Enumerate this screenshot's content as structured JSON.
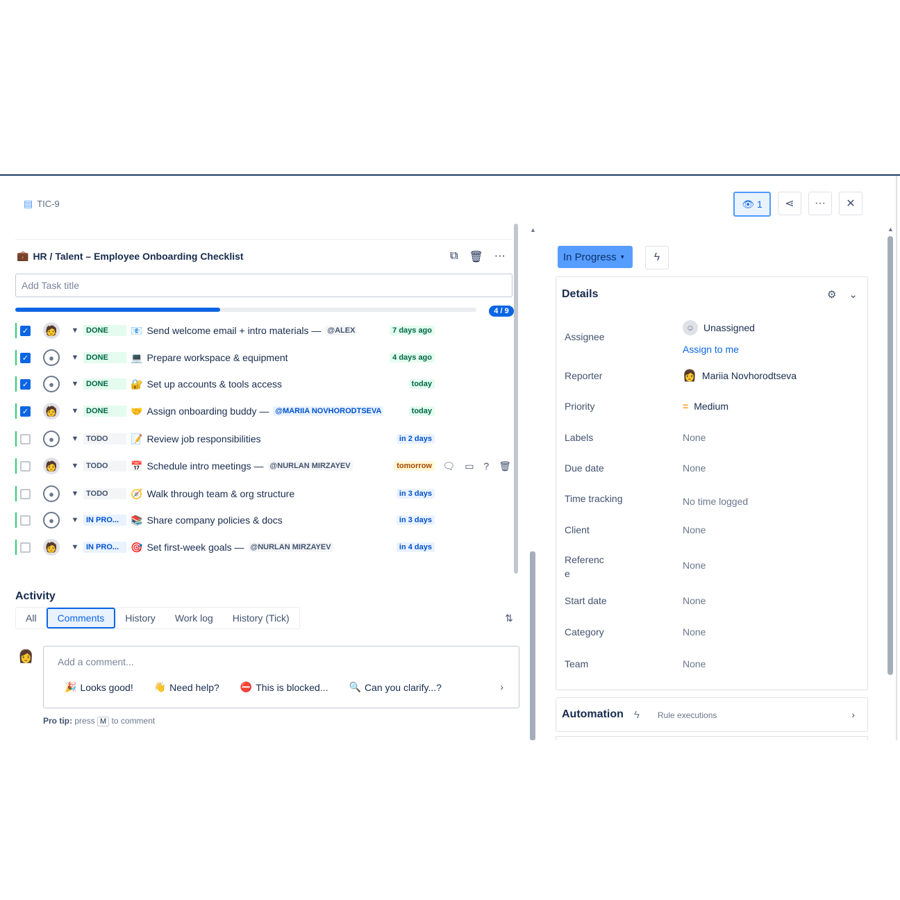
{
  "header": {
    "issue_key": "TIC-9",
    "watch_count": "1",
    "actions": [
      "eye-icon",
      "share-icon",
      "more-icon",
      "close-icon"
    ]
  },
  "checklist": {
    "title": "HR / Talent – Employee Onboarding Checklist",
    "add_placeholder": "Add Task title",
    "progress_fraction": 0.444,
    "progress_label": "4 / 9",
    "tasks": [
      {
        "checked": true,
        "avatar": "photo",
        "status": "DONE",
        "icon": "📧",
        "name": "Send welcome email + intro materials —",
        "mention": "@ALEX",
        "mention_style": "grey",
        "due": "7 days ago",
        "due_style": "green"
      },
      {
        "checked": true,
        "avatar": "default",
        "status": "DONE",
        "icon": "💻",
        "name": "Prepare workspace & equipment",
        "mention": "",
        "mention_style": "",
        "due": "4 days ago",
        "due_style": "green"
      },
      {
        "checked": true,
        "avatar": "default",
        "status": "DONE",
        "icon": "🔐",
        "name": "Set up accounts & tools access",
        "mention": "",
        "mention_style": "",
        "due": "today",
        "due_style": "green"
      },
      {
        "checked": true,
        "avatar": "photo",
        "status": "DONE",
        "icon": "🤝",
        "name": "Assign onboarding buddy —",
        "mention": "@MARIIA NOVHORODTSEVA",
        "mention_style": "blue",
        "due": "today",
        "due_style": "green"
      },
      {
        "checked": false,
        "avatar": "default",
        "status": "TODO",
        "icon": "📝",
        "name": "Review job responsibilities",
        "mention": "",
        "mention_style": "",
        "due": "in 2 days",
        "due_style": "blue"
      },
      {
        "checked": false,
        "avatar": "photo",
        "status": "TODO",
        "icon": "📅",
        "name": "Schedule intro meetings —",
        "mention": "@NURLAN MIRZAYEV",
        "mention_style": "grey",
        "due": "tomorrow",
        "due_style": "orange"
      },
      {
        "checked": false,
        "avatar": "default",
        "status": "TODO",
        "icon": "🧭",
        "name": "Walk through team & org structure",
        "mention": "",
        "mention_style": "",
        "due": "in 3 days",
        "due_style": "blue"
      },
      {
        "checked": false,
        "avatar": "default",
        "status": "IN PRO...",
        "icon": "📚",
        "name": "Share company policies & docs",
        "mention": "",
        "mention_style": "",
        "due": "in 3 days",
        "due_style": "blue"
      },
      {
        "checked": false,
        "avatar": "photo",
        "status": "IN PRO...",
        "icon": "🎯",
        "name": "Set first-week goals —",
        "mention": "@NURLAN MIRZAYEV",
        "mention_style": "grey",
        "due": "in 4 days",
        "due_style": "blue"
      }
    ]
  },
  "activity": {
    "heading": "Activity",
    "tabs": [
      "All",
      "Comments",
      "History",
      "Work log",
      "History (Tick)"
    ],
    "active_tab": "Comments",
    "comment_placeholder": "Add a comment...",
    "quick_replies": [
      {
        "emoji": "🎉",
        "text": "Looks good!"
      },
      {
        "emoji": "👋",
        "text": "Need help?"
      },
      {
        "emoji": "⛔",
        "text": "This is blocked..."
      },
      {
        "emoji": "🔍",
        "text": "Can you clarify...?"
      }
    ],
    "tip_prefix": "Pro tip:",
    "tip_press": "press",
    "tip_key": "M",
    "tip_suffix": "to comment"
  },
  "sidebar": {
    "status": "In Progress",
    "details_title": "Details",
    "fields": [
      {
        "label": "Assignee",
        "value": "Unassigned",
        "extra": "Assign to me"
      },
      {
        "label": "Reporter",
        "value": "Mariia Novhorodtseva"
      },
      {
        "label": "Priority",
        "value": "Medium"
      },
      {
        "label": "Labels",
        "value": "None"
      },
      {
        "label": "Due date",
        "value": "None"
      },
      {
        "label": "Time tracking",
        "value": "No time logged"
      },
      {
        "label": "Client",
        "value": "None"
      },
      {
        "label": "Referenc\ne",
        "value": "None"
      },
      {
        "label": "Start date",
        "value": "None"
      },
      {
        "label": "Category",
        "value": "None"
      },
      {
        "label": "Team",
        "value": "None"
      }
    ],
    "automation": {
      "title": "Automation",
      "subtitle": "Rule executions"
    }
  },
  "colors": {
    "accent": "#0c66e4",
    "status_button": "#579dff",
    "done_bg": "#e3fcef"
  }
}
